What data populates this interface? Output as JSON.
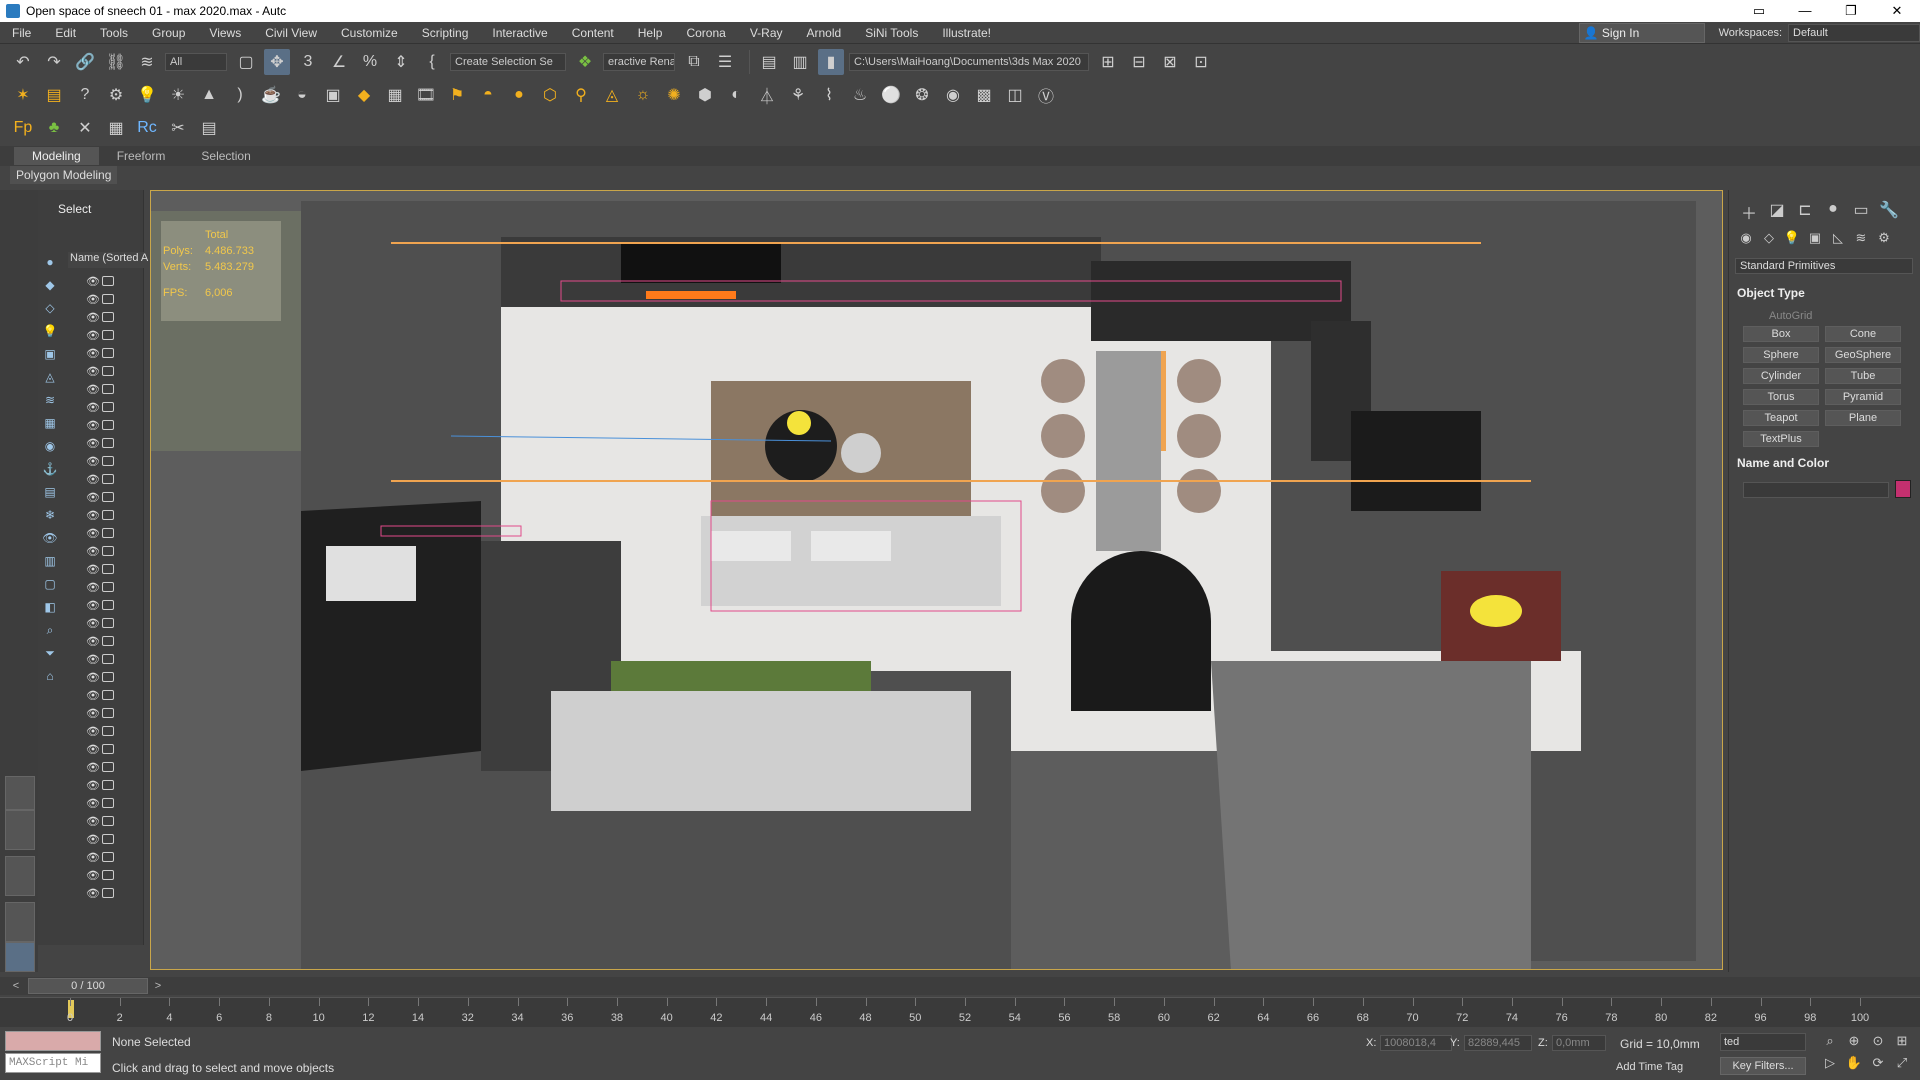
{
  "title": "Open space of sneech 01 - max 2020.max - Autc",
  "window_controls": [
    "▭",
    "—",
    "❐",
    "✕"
  ],
  "menu": [
    "File",
    "Edit",
    "Tools",
    "Group",
    "Views",
    "Civil View",
    "Customize",
    "Scripting",
    "Interactive",
    "Content",
    "Help",
    "Corona",
    "V-Ray",
    "Arnold",
    "SiNi Tools",
    "Illustrate!"
  ],
  "signin": "Sign In",
  "workspaces_label": "Workspaces:",
  "workspace": "Default",
  "toolbar": {
    "filter": "All",
    "selection_set": "Create Selection Se",
    "interactive_rename": "eractive Renar",
    "path": "C:\\Users\\MaiHoang\\Documents\\3ds Max 2020"
  },
  "ribbon": {
    "tabs": [
      "Modeling",
      "Freeform",
      "Selection"
    ],
    "sub": "Polygon Modeling"
  },
  "explorer": {
    "title": "Select",
    "header": "Name (Sorted A"
  },
  "stats": {
    "total_label": "Total",
    "polys_label": "Polys:",
    "polys": "4.486.733",
    "verts_label": "Verts:",
    "verts": "5.483.279",
    "fps_label": "FPS:",
    "fps": "6,006"
  },
  "cmdpanel": {
    "category": "Standard Primitives",
    "object_type": "Object Type",
    "autogrid": "AutoGrid",
    "primitives": [
      "Box",
      "Cone",
      "Sphere",
      "GeoSphere",
      "Cylinder",
      "Tube",
      "Torus",
      "Pyramid",
      "Teapot",
      "Plane",
      "TextPlus"
    ],
    "name_color": "Name and Color",
    "color": "#c4306f"
  },
  "timeline": {
    "range": "0 / 100",
    "ticks": [
      "0",
      "2",
      "4",
      "6",
      "8",
      "10",
      "12",
      "14",
      "32",
      "34",
      "36",
      "38",
      "40",
      "42",
      "44",
      "46",
      "48",
      "50",
      "52",
      "54",
      "56",
      "58",
      "60",
      "62",
      "64",
      "66",
      "68",
      "70",
      "72",
      "74",
      "76",
      "78",
      "80",
      "82",
      "96",
      "98",
      "100"
    ]
  },
  "status": {
    "selection": "None Selected",
    "prompt": "Click and drag to select and move objects",
    "maxscript": "MAXScript Mi",
    "x_label": "X:",
    "x": "1008018,4",
    "y_label": "Y:",
    "y": "82889,445",
    "z_label": "Z:",
    "z": "0,0mm",
    "grid": "Grid = 10,0mm",
    "selected_dropdown": "ted",
    "add_time_tag": "Add Time Tag",
    "key_filters": "Key Filters..."
  }
}
